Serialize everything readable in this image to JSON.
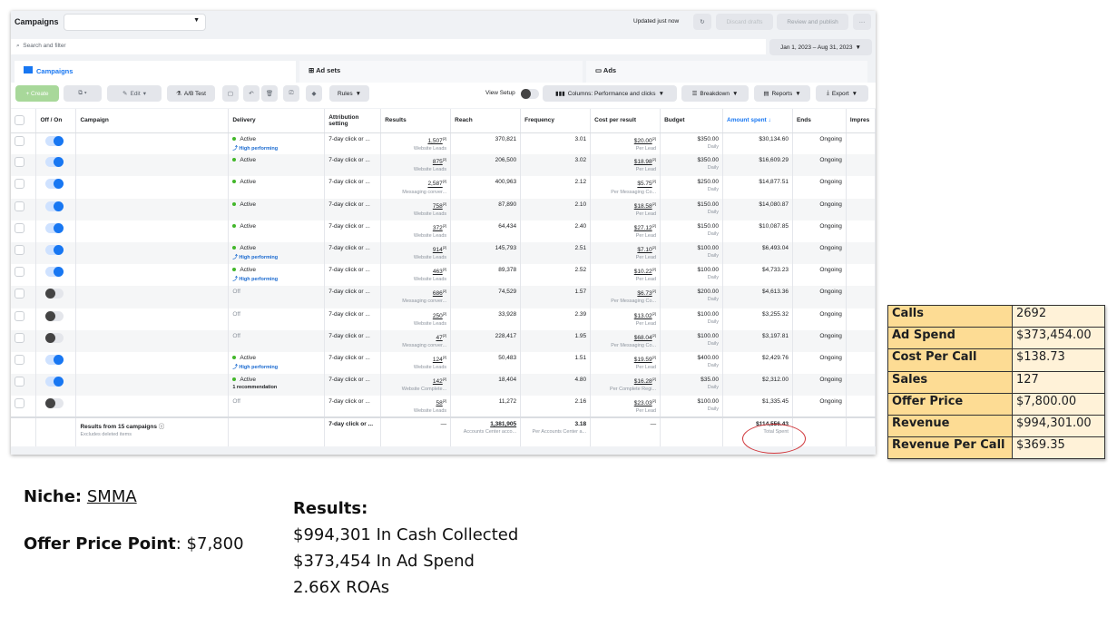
{
  "header": {
    "title": "Campaigns",
    "updated": "Updated just now",
    "discard": "Discard drafts",
    "review": "Review and publish",
    "more": "···"
  },
  "search": {
    "placeholder": "Search and filter",
    "date_range": "Jan 1, 2023 – Aug 31, 2023"
  },
  "tabs": [
    {
      "label": "Campaigns"
    },
    {
      "label": "Ad sets"
    },
    {
      "label": "Ads"
    }
  ],
  "toolbar": {
    "create": "+ Create",
    "edit": "Edit",
    "ab_test": "A/B Test",
    "rules": "Rules",
    "view_setup": "View Setup",
    "columns": "Columns: Performance and clicks",
    "breakdown": "Breakdown",
    "reports": "Reports",
    "export": "Export"
  },
  "columns": [
    "Off / On",
    "Campaign",
    "Delivery",
    "Attribution setting",
    "Results",
    "Reach",
    "Frequency",
    "Cost per result",
    "Budget",
    "Amount spent ↓",
    "Ends",
    "Impres"
  ],
  "accent": "#1877f2",
  "rows": [
    {
      "on": true,
      "delivery": "Active",
      "tag": "High performing",
      "attr": "7-day click or ...",
      "results": "1,507",
      "results_type": "Website Leads",
      "reach": "370,821",
      "freq": "3.01",
      "cpr": "$20.00",
      "cpr_type": "Per Lead",
      "budget": "$350.00",
      "budget_type": "Daily",
      "spent": "$30,134.60",
      "ends": "Ongoing"
    },
    {
      "on": true,
      "delivery": "Active",
      "tag": "",
      "attr": "7-day click or ...",
      "results": "875",
      "results_type": "Website Leads",
      "reach": "206,500",
      "freq": "3.02",
      "cpr": "$18.98",
      "cpr_type": "Per Lead",
      "budget": "$350.00",
      "budget_type": "Daily",
      "spent": "$16,609.29",
      "ends": "Ongoing"
    },
    {
      "on": true,
      "delivery": "Active",
      "tag": "",
      "attr": "7-day click or ...",
      "results": "2,587",
      "results_type": "Messaging conver...",
      "reach": "400,963",
      "freq": "2.12",
      "cpr": "$5.75",
      "cpr_type": "Per Messaging Co...",
      "budget": "$250.00",
      "budget_type": "Daily",
      "spent": "$14,877.51",
      "ends": "Ongoing"
    },
    {
      "on": true,
      "delivery": "Active",
      "tag": "",
      "attr": "7-day click or ...",
      "results": "758",
      "results_type": "Website Leads",
      "reach": "87,890",
      "freq": "2.10",
      "cpr": "$18.58",
      "cpr_type": "Per Lead",
      "budget": "$150.00",
      "budget_type": "Daily",
      "spent": "$14,080.87",
      "ends": "Ongoing"
    },
    {
      "on": true,
      "delivery": "Active",
      "tag": "",
      "attr": "7-day click or ...",
      "results": "372",
      "results_type": "Website Leads",
      "reach": "64,434",
      "freq": "2.40",
      "cpr": "$27.12",
      "cpr_type": "Per Lead",
      "budget": "$150.00",
      "budget_type": "Daily",
      "spent": "$10,087.85",
      "ends": "Ongoing"
    },
    {
      "on": true,
      "delivery": "Active",
      "tag": "High performing",
      "attr": "7-day click or ...",
      "results": "914",
      "results_type": "Website Leads",
      "reach": "145,793",
      "freq": "2.51",
      "cpr": "$7.10",
      "cpr_type": "Per Lead",
      "budget": "$100.00",
      "budget_type": "Daily",
      "spent": "$6,493.04",
      "ends": "Ongoing"
    },
    {
      "on": true,
      "delivery": "Active",
      "tag": "High performing",
      "attr": "7-day click or ...",
      "results": "463",
      "results_type": "Website Leads",
      "reach": "89,378",
      "freq": "2.52",
      "cpr": "$10.22",
      "cpr_type": "Per Lead",
      "budget": "$100.00",
      "budget_type": "Daily",
      "spent": "$4,733.23",
      "ends": "Ongoing"
    },
    {
      "on": false,
      "delivery": "Off",
      "tag": "",
      "attr": "7-day click or ...",
      "results": "686",
      "results_type": "Messaging conver...",
      "reach": "74,529",
      "freq": "1.57",
      "cpr": "$6.73",
      "cpr_type": "Per Messaging Co...",
      "budget": "$200.00",
      "budget_type": "Daily",
      "spent": "$4,613.36",
      "ends": "Ongoing"
    },
    {
      "on": false,
      "delivery": "Off",
      "tag": "",
      "attr": "7-day click or ...",
      "results": "250",
      "results_type": "Website Leads",
      "reach": "33,928",
      "freq": "2.39",
      "cpr": "$13.02",
      "cpr_type": "Per Lead",
      "budget": "$100.00",
      "budget_type": "Daily",
      "spent": "$3,255.32",
      "ends": "Ongoing"
    },
    {
      "on": false,
      "delivery": "Off",
      "tag": "",
      "attr": "7-day click or ...",
      "results": "47",
      "results_type": "Messaging conver...",
      "reach": "228,417",
      "freq": "1.95",
      "cpr": "$68.04",
      "cpr_type": "Per Messaging Co...",
      "budget": "$100.00",
      "budget_type": "Daily",
      "spent": "$3,197.81",
      "ends": "Ongoing"
    },
    {
      "on": true,
      "delivery": "Active",
      "tag": "High performing",
      "attr": "7-day click or ...",
      "results": "124",
      "results_type": "Website Leads",
      "reach": "50,483",
      "freq": "1.51",
      "cpr": "$19.59",
      "cpr_type": "Per Lead",
      "budget": "$400.00",
      "budget_type": "Daily",
      "spent": "$2,429.76",
      "ends": "Ongoing"
    },
    {
      "on": true,
      "delivery": "Active",
      "tag": "1 recommendation",
      "attr": "7-day click or ...",
      "results": "142",
      "results_type": "Website Complete...",
      "reach": "18,404",
      "freq": "4.80",
      "cpr": "$16.28",
      "cpr_type": "Per Complete Regi...",
      "budget": "$35.00",
      "budget_type": "Daily",
      "spent": "$2,312.00",
      "ends": "Ongoing"
    },
    {
      "on": false,
      "delivery": "Off",
      "tag": "",
      "attr": "7-day click or ...",
      "results": "58",
      "results_type": "Website Leads",
      "reach": "11,272",
      "freq": "2.16",
      "cpr": "$23.03",
      "cpr_type": "Per Lead",
      "budget": "$100.00",
      "budget_type": "Daily",
      "spent": "$1,335.45",
      "ends": "Ongoing"
    }
  ],
  "summary": {
    "label": "Results from 15 campaigns",
    "sub": "Excludes deleted items",
    "attr": "7-day click or ...",
    "results": "—",
    "reach": "1,381,905",
    "reach_sub": "Accounts Center acco...",
    "freq": "3.18",
    "freq_sub": "Per Accounts Center a...",
    "cpr": "—",
    "spent": "$114,556.43",
    "spent_sub": "Total Spent"
  },
  "kpi": [
    {
      "k": "Calls",
      "v": "2692"
    },
    {
      "k": "Ad Spend",
      "v": "$373,454.00"
    },
    {
      "k": "Cost Per Call",
      "v": "$138.73"
    },
    {
      "k": "Sales",
      "v": "127"
    },
    {
      "k": "Offer Price",
      "v": "$7,800.00"
    },
    {
      "k": "Revenue",
      "v": "$994,301.00"
    },
    {
      "k": "Revenue Per Call",
      "v": "$369.35"
    }
  ],
  "notes": {
    "niche_label": "Niche:",
    "niche": "SMMA",
    "offer_label": "Offer Price Point",
    "offer": ": $7,800",
    "results_title": "Results:",
    "lines": [
      "$994,301 In Cash Collected",
      "$373,454 In Ad Spend",
      "2.66X ROAs"
    ]
  }
}
